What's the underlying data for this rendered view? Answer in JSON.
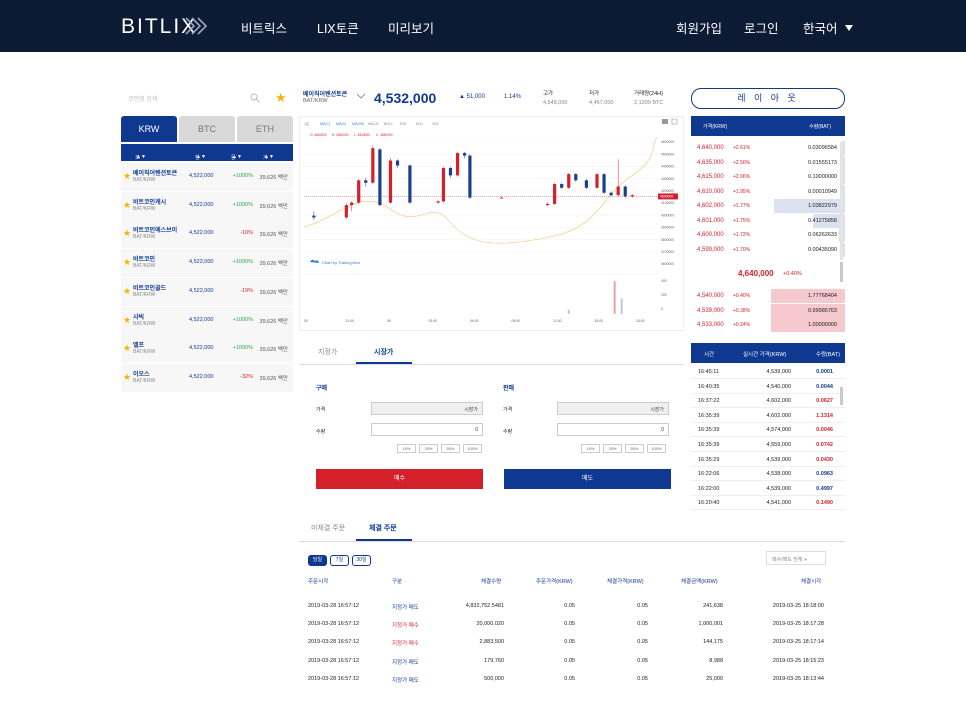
{
  "header": {
    "logo": "BITLIX",
    "nav": [
      "비트릭스",
      "LIX토큰",
      "미리보기"
    ],
    "signup": "회원가입",
    "login": "로그인",
    "language": "한국어"
  },
  "market": {
    "search_placeholder": "코인명 검색",
    "tabs": [
      "KRW",
      "BTC",
      "ETH"
    ],
    "active_tab": "KRW",
    "columns": [
      "코인명",
      "현재가",
      "등락률",
      "거래대금"
    ],
    "rows": [
      {
        "name": "베이직어텐션토큰",
        "pair": "BAT/KRW",
        "price": "4,522,000",
        "change": "+1000%",
        "dir": "up",
        "volume": "39,626 백만"
      },
      {
        "name": "비트코인캐시",
        "pair": "BAT/KRW",
        "price": "4,522,000",
        "change": "+1000%",
        "dir": "up",
        "volume": "39,626 백만"
      },
      {
        "name": "비트코인에스브이",
        "pair": "BAT/KRW",
        "price": "4,522,000",
        "change": "-10%",
        "dir": "down",
        "volume": "39,626 백만"
      },
      {
        "name": "비트코인",
        "pair": "BAT/KRW",
        "price": "4,522,000",
        "change": "+1000%",
        "dir": "up",
        "volume": "39,626 백만"
      },
      {
        "name": "비트코인골드",
        "pair": "BAT/KRW",
        "price": "4,522,000",
        "change": "-19%",
        "dir": "down",
        "volume": "39,626 백만"
      },
      {
        "name": "샤빅",
        "pair": "BAT/KRW",
        "price": "4,522,000",
        "change": "+1000%",
        "dir": "up",
        "volume": "39,626 백만"
      },
      {
        "name": "엘프",
        "pair": "BAT/KRW",
        "price": "4,522,000",
        "change": "+1000%",
        "dir": "up",
        "volume": "39,626 백만"
      },
      {
        "name": "이오스",
        "pair": "BAT/KRW",
        "price": "4,522,000",
        "change": "-32%",
        "dir": "down",
        "volume": "39,626 백만"
      }
    ]
  },
  "coin": {
    "name": "베이직어텐션토큰",
    "pair": "BAT/KRW",
    "price": "4,532,000",
    "change_amount": "▲ 51,000",
    "change_pct": "1.14%",
    "high_label": "고가",
    "high": "4,548,000",
    "low_label": "저가",
    "low": "4,467,000",
    "volume_label": "거래량(24H)",
    "volume": "2,1399 BTC"
  },
  "layout_button": "레 이 아 웃",
  "chart": {
    "toolbar": [
      "1분",
      "MA(7)",
      "MA(9)",
      "MA(99)",
      "MACD",
      "BOLL",
      "RSI",
      "KDJ",
      "VOL"
    ],
    "legend": [
      "O: 4540000",
      "H: 4540000",
      "L: 4540000",
      "C: 4540000"
    ],
    "y_ticks": [
      "4600000",
      "4500000",
      "4400000",
      "4300000",
      "4200000",
      "4100000",
      "4000000",
      "3900000",
      "3800000",
      "3700000",
      "3600000"
    ],
    "last_label": "4540000",
    "vol_ticks": [
      "400",
      "200",
      "0"
    ],
    "x_ticks": [
      "00",
      "21:00",
      "08",
      "03:00",
      "06:00",
      "09:00",
      "12:00",
      "15:00",
      "18:00"
    ],
    "attribution": "Chart by TradingView"
  },
  "chart_data": {
    "type": "candlestick",
    "y_range": [
      3600000,
      4650000
    ],
    "candles": [
      [
        0.028,
        4015000,
        4000000,
        4050000,
        3980000
      ],
      [
        0.12,
        4000000,
        4100000,
        4110000,
        3990000
      ],
      [
        0.135,
        4100000,
        4120000,
        4130000,
        4050000
      ],
      [
        0.155,
        4120000,
        4300000,
        4310000,
        4110000
      ],
      [
        0.175,
        4300000,
        4280000,
        4320000,
        4250000
      ],
      [
        0.195,
        4280000,
        4560000,
        4580000,
        4270000
      ],
      [
        0.215,
        4550000,
        4100000,
        4560000,
        4090000
      ],
      [
        0.245,
        4120000,
        4460000,
        4480000,
        4110000
      ],
      [
        0.265,
        4460000,
        4420000,
        4470000,
        4400000
      ],
      [
        0.3,
        4420000,
        4120000,
        4430000,
        4110000
      ],
      [
        0.38,
        4120000,
        4130000,
        4140000,
        4110000
      ],
      [
        0.395,
        4130000,
        4400000,
        4410000,
        4120000
      ],
      [
        0.415,
        4400000,
        4340000,
        4410000,
        4320000
      ],
      [
        0.435,
        4340000,
        4520000,
        4530000,
        4330000
      ],
      [
        0.455,
        4520000,
        4500000,
        4530000,
        4480000
      ],
      [
        0.47,
        4500000,
        4160000,
        4510000,
        4150000
      ],
      [
        0.56,
        4160000,
        4160000,
        4170000,
        4150000
      ],
      [
        0.69,
        4100000,
        4110000,
        4120000,
        4090000
      ],
      [
        0.71,
        4110000,
        4270000,
        4280000,
        4100000
      ],
      [
        0.73,
        4270000,
        4240000,
        4280000,
        4230000
      ],
      [
        0.75,
        4240000,
        4350000,
        4360000,
        4230000
      ],
      [
        0.77,
        4350000,
        4300000,
        4360000,
        4290000
      ],
      [
        0.8,
        4300000,
        4240000,
        4310000,
        4230000
      ],
      [
        0.83,
        4240000,
        4350000,
        4360000,
        4230000
      ],
      [
        0.85,
        4350000,
        4200000,
        4360000,
        4190000
      ],
      [
        0.87,
        4200000,
        4180000,
        4210000,
        4170000
      ],
      [
        0.89,
        4180000,
        4250000,
        4470000,
        4170000
      ],
      [
        0.91,
        4250000,
        4170000,
        4260000,
        4160000
      ],
      [
        0.93,
        4170000,
        4180000,
        4190000,
        4160000
      ]
    ],
    "volume": [
      [
        0.75,
        60
      ],
      [
        0.88,
        470
      ],
      [
        0.9,
        220
      ]
    ]
  },
  "orderbook": {
    "headers": [
      "가격(KRW)",
      "수량(BAT)"
    ],
    "asks": [
      {
        "price": "4,640,000",
        "pct": "+2.61%",
        "qty": "0.03096584",
        "bar": 0.02
      },
      {
        "price": "4,635,000",
        "pct": "+2.50%",
        "qty": "0.01555173",
        "bar": 0.02
      },
      {
        "price": "4,615,000",
        "pct": "+2.06%",
        "qty": "0.10000000",
        "bar": 0.03
      },
      {
        "price": "4,610,000",
        "pct": "+1.95%",
        "qty": "0.00010949",
        "bar": 0.01
      },
      {
        "price": "4,602,000",
        "pct": "+1.77%",
        "qty": "1.03822979",
        "bar": 0.47
      },
      {
        "price": "4,601,000",
        "pct": "+1.75%",
        "qty": "0.41275858",
        "bar": 0.21
      },
      {
        "price": "4,600,000",
        "pct": "+1.72%",
        "qty": "0.06262633",
        "bar": 0.04
      },
      {
        "price": "4,599,000",
        "pct": "+1.70%",
        "qty": "0.00435090",
        "bar": 0.01
      }
    ],
    "mid_price": "4,640,000",
    "mid_pct": "+0.40%",
    "bids": [
      {
        "price": "4,540,000",
        "pct": "+0.40%",
        "qty": "1.77768404",
        "bar": 0.49
      },
      {
        "price": "4,539,000",
        "pct": "+0.38%",
        "qty": "0.99985763",
        "bar": 0.49
      },
      {
        "price": "4,533,000",
        "pct": "+0.24%",
        "qty": "1.00000000",
        "bar": 0.49
      }
    ]
  },
  "order_form": {
    "tabs": [
      "지정가",
      "시장가"
    ],
    "buy_title": "구매",
    "sell_title": "판매",
    "price_label": "가격",
    "qty_label": "수량",
    "price_value": "시장가",
    "qty_value": "0",
    "pct_buttons": [
      "10%",
      "25%",
      "50%",
      "100%"
    ],
    "buy_button": "매수",
    "sell_button": "매도"
  },
  "trades": {
    "headers": [
      "시간",
      "실시간 가격(KRW)",
      "수량(BAT)"
    ],
    "rows": [
      {
        "time": "16:45:11",
        "price": "4,539,000",
        "qty": "0.0001",
        "side": "buy"
      },
      {
        "time": "16:40:35",
        "price": "4,540,000",
        "qty": "0.0044",
        "side": "buy"
      },
      {
        "time": "16:37:22",
        "price": "4,602,000",
        "qty": "0.0627",
        "side": "sell"
      },
      {
        "time": "16:35:39",
        "price": "4,602,000",
        "qty": "1.1314",
        "side": "sell"
      },
      {
        "time": "16:35:39",
        "price": "4,574,000",
        "qty": "0.0046",
        "side": "sell"
      },
      {
        "time": "16:35:39",
        "price": "4,559,000",
        "qty": "0.0742",
        "side": "sell"
      },
      {
        "time": "16:35:29",
        "price": "4,539,000",
        "qty": "0.0430",
        "side": "sell"
      },
      {
        "time": "16:22:06",
        "price": "4,538,000",
        "qty": "0.0963",
        "side": "buy"
      },
      {
        "time": "16:22:00",
        "price": "4,539,000",
        "qty": "0.4997",
        "side": "buy"
      },
      {
        "time": "16:20:40",
        "price": "4,541,000",
        "qty": "0.1490",
        "side": "sell"
      }
    ]
  },
  "history": {
    "tabs": [
      "미체결 주문",
      "체결 주문"
    ],
    "ranges": [
      "당일",
      "7일",
      "30일"
    ],
    "filter": "매수/매도 전체",
    "columns": [
      "주문시각",
      "구분",
      "체결수량",
      "주문가격(KRW)",
      "체결가격(KRW)",
      "체결금액(KRW)",
      "체결시각"
    ],
    "rows": [
      {
        "ordered": "2019-03-28 16:57:12",
        "type": "지정가 매도",
        "side": "sell",
        "qty": "4,832,752.5481",
        "order_price": "0.05",
        "fill_price": "0.05",
        "amount": "241,638",
        "filled": "2019-03-25 18:18:00"
      },
      {
        "ordered": "2019-03-28 16:57:12",
        "type": "지정가 매수",
        "side": "buy",
        "qty": "20,000,020",
        "order_price": "0.05",
        "fill_price": "0.05",
        "amount": "1,000,001",
        "filled": "2019-03-25 18:17:28"
      },
      {
        "ordered": "2019-03-28 16:57:12",
        "type": "지정가 매수",
        "side": "buy",
        "qty": "2,883,500",
        "order_price": "0.05",
        "fill_price": "0.05",
        "amount": "144,175",
        "filled": "2019-03-25 18:17:14"
      },
      {
        "ordered": "2019-03-28 16:57:12",
        "type": "지정가 매도",
        "side": "sell",
        "qty": "179,760",
        "order_price": "0.05",
        "fill_price": "0.05",
        "amount": "8,988",
        "filled": "2019-03-25 18:15:23"
      },
      {
        "ordered": "2019-03-28 16:57:12",
        "type": "지정가 매도",
        "side": "sell",
        "qty": "500,000",
        "order_price": "0.05",
        "fill_price": "0.05",
        "amount": "25,000",
        "filled": "2019-03-25 18:13:44"
      }
    ]
  }
}
